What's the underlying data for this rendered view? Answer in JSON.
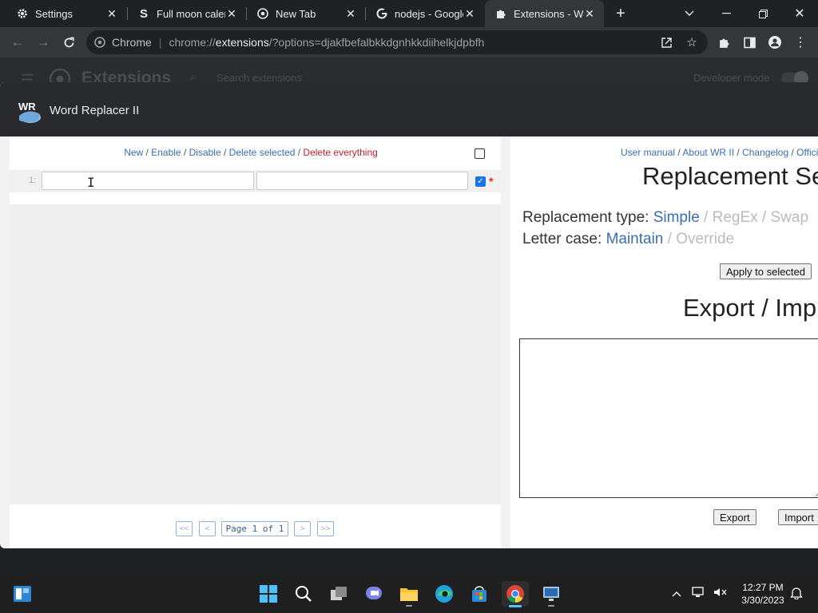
{
  "tabs": [
    {
      "title": "Settings",
      "icon": "gear-icon"
    },
    {
      "title": "Full moon calen",
      "icon": "s-logo-icon"
    },
    {
      "title": "New Tab",
      "icon": "chrome-icon"
    },
    {
      "title": "nodejs - Google",
      "icon": "google-icon"
    },
    {
      "title": "Extensions - Wo",
      "icon": "puzzle-icon"
    }
  ],
  "address_bar": {
    "scheme_label": "Chrome",
    "prefix": "chrome://",
    "host": "extensions",
    "path": "/?options=djakfbefalbkkdgnhkkdiihelkjdpbfh"
  },
  "extensions_page": {
    "title": "Extensions",
    "search_placeholder": "Search extensions",
    "developer_mode_label": "Developer mode"
  },
  "dialog": {
    "title": "Word Replacer II",
    "logo_text": "WR",
    "left": {
      "actions": {
        "new": "New",
        "enable": "Enable",
        "disable": "Disable",
        "delete_selected": "Delete selected",
        "delete_everything": "Delete everything",
        "separator": " / "
      },
      "row_number": "1:",
      "row_star": "*",
      "pager": {
        "first": "<<",
        "prev": "<",
        "label": "Page 1 of 1",
        "next": ">",
        "last": ">>"
      }
    },
    "right": {
      "links": {
        "user_manual": "User manual",
        "about": "About WR II",
        "changelog": "Changelog",
        "official": "Offici",
        "separator": " / "
      },
      "title": "Replacement Se",
      "replacement_type": {
        "label": "Replacement type: ",
        "simple": "Simple",
        "regex": "RegEx",
        "swap": "Swap",
        "separator": " / "
      },
      "letter_case": {
        "label": "Letter case: ",
        "maintain": "Maintain",
        "override": "Override",
        "separator": " / "
      },
      "apply_button": "Apply to selected",
      "export_title": "Export / Imp",
      "export_button": "Export",
      "import_button": "Import"
    }
  },
  "taskbar": {
    "time": "12:27 PM",
    "date": "3/30/2023"
  },
  "colors": {
    "link": "#3b6db3",
    "danger_link": "#c0212b",
    "checkbox_checked": "#1a73e8",
    "dialog_header": "#292a2d"
  }
}
